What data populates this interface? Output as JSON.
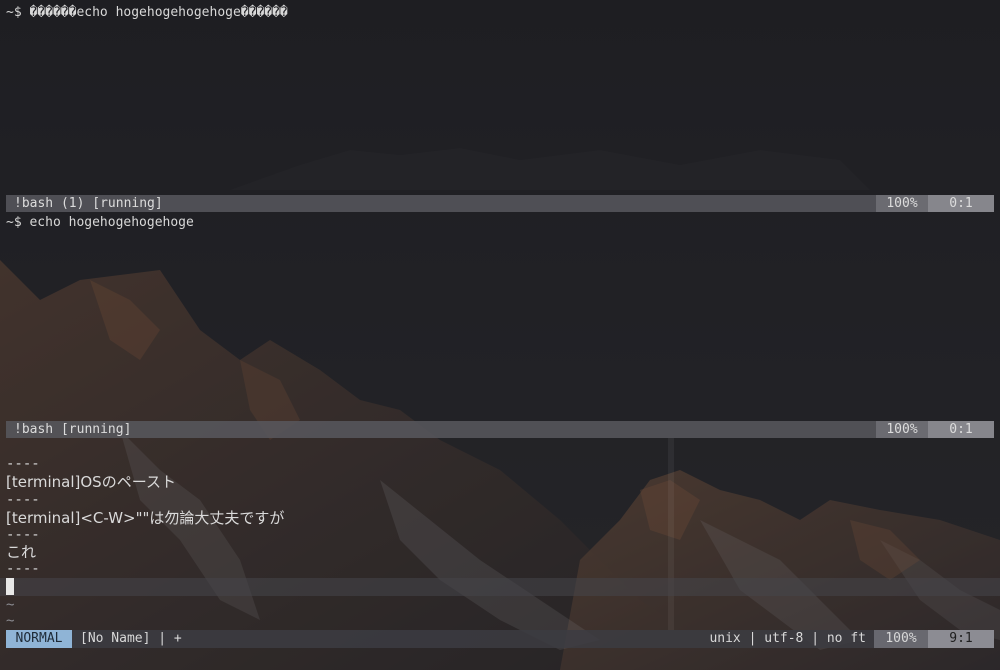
{
  "pane_top": {
    "line": "~$ ������echo hogehogehogehoge������",
    "status": {
      "title": "!bash (1) [running]",
      "percent": "100%",
      "position": "0:1"
    }
  },
  "pane_middle": {
    "line": "~$ echo hogehogehogehoge",
    "status": {
      "title": "!bash [running]",
      "percent": "100%",
      "position": "0:1"
    }
  },
  "buffer": {
    "lines": [
      "----",
      "[terminal]OSのペースト",
      "----",
      "[terminal]<C-W>\"\"は勿論大丈夫ですが",
      "----",
      "これ",
      "----"
    ],
    "tildes": [
      "~",
      "~"
    ]
  },
  "vim_status": {
    "mode": "NORMAL",
    "bufname": "[No Name] | +",
    "fileinfo": "unix | utf-8 | no ft",
    "percent": "100%",
    "position": "9:1"
  },
  "colors": {
    "mode_bg": "#8fb4d6",
    "statusbar_bg": "#58585e"
  }
}
